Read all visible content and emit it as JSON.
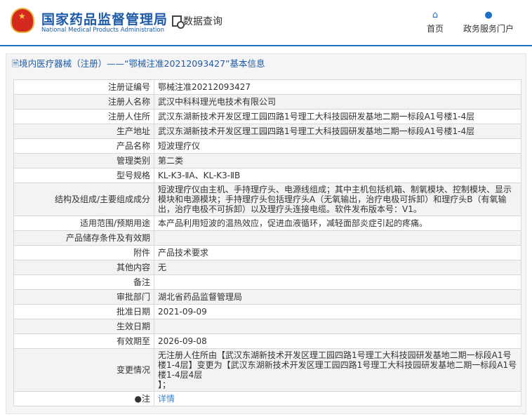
{
  "header": {
    "logo_cn": "国家药品监督管理局",
    "logo_en": "National Medical Products Administration",
    "query": "数据查询",
    "nav": [
      {
        "label": "首页",
        "icon": "home-icon"
      },
      {
        "label": "政务服务门户",
        "icon": "user-icon"
      }
    ]
  },
  "panel": {
    "title": "境内医疗器械（注册）——“鄂械注准20212093427”基本信息"
  },
  "rows": [
    {
      "k": "注册证编号",
      "v": "鄂械注准20212093427"
    },
    {
      "k": "注册人名称",
      "v": "武汉中科科理光电技术有限公司"
    },
    {
      "k": "注册人住所",
      "v": "武汉东湖新技术开发区理工园四路1号理工大科技园研发基地二期一标段A1号楼1-4层"
    },
    {
      "k": "生产地址",
      "v": "武汉东湖新技术开发区理工园四路1号理工大科技园研发基地二期一标段A1号楼1-4层"
    },
    {
      "k": "产品名称",
      "v": "短波理疗仪"
    },
    {
      "k": "管理类别",
      "v": "第二类"
    },
    {
      "k": "型号规格",
      "v": "KL-K3-ⅡA、KL-K3-ⅡB"
    },
    {
      "k": "结构及组成/主要组成成分",
      "v": "短波理疗仪由主机、手持理疗头、电源线组成；其中主机包括机箱、制氧模块、控制模块、显示模块和电源模块；手持理疗头包括理疗头A（无氧输出，治疗电极可拆卸）和理疗头B（有氧输出，治疗电极不可拆卸）以及理疗头连接电缆。软件发布版本号：V1。"
    },
    {
      "k": "适用范围/预期用途",
      "v": "本产品利用短波的温热效应，促进血液循环，减轻面部炎症引起的疼痛。"
    },
    {
      "k": "产品储存条件及有效期",
      "v": ""
    },
    {
      "k": "附件",
      "v": "产品技术要求"
    },
    {
      "k": "其他内容",
      "v": "无"
    },
    {
      "k": "备注",
      "v": ""
    },
    {
      "k": "审批部门",
      "v": "湖北省药品监督管理局"
    },
    {
      "k": "批准日期",
      "v": "2021-09-09"
    },
    {
      "k": "生效日期",
      "v": ""
    },
    {
      "k": "有效期至",
      "v": "2026-09-08"
    },
    {
      "k": "变更情况",
      "v": "无注册人住所由【武汉东湖新技术开发区理工园四路1号理工大科技园研发基地二期一标段A1号楼1-4层】变更为【武汉东湖新技术开发区理工园四路1号理工大科技园研发基地二期一标段A1号楼1-4层4层\n】；"
    }
  ],
  "note": {
    "k": "注",
    "link": "详情"
  }
}
